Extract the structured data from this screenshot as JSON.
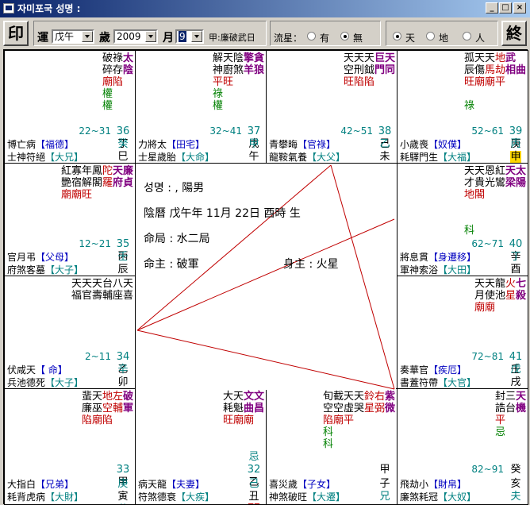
{
  "window": {
    "title": "자미포국    성명 :",
    "minimize": "_",
    "maximize": "□",
    "close": "×"
  },
  "toolbar": {
    "print_label": "印",
    "fortune_label": "運",
    "fortune_value": "戊午",
    "year_label": "歲",
    "year_value": "2009",
    "month_label": "月",
    "month_value": "9",
    "info_text": "甲:廉破武日",
    "flow_label": "流星：",
    "flow_options": [
      "有",
      "無"
    ],
    "flow_selected": 1,
    "view_options": [
      "天",
      "地",
      "人"
    ],
    "view_selected": 0,
    "end_label": "終"
  },
  "center": {
    "name_line": "성명 : , 陽男",
    "lunar_line": "陰曆  戊午年  11月  22日  酉時  生",
    "ming_ju_label": "命局 :",
    "ming_ju_value": "水二局",
    "ming_zhu_label": "命主 :",
    "ming_zhu_value": "破軍",
    "shen_zhu_label": "身主 :",
    "shen_zhu_value": "火星"
  },
  "palaces": [
    {
      "id": "si",
      "stars": [
        {
          "t": "破碎",
          "c": ""
        },
        {
          "t": "祿存",
          "c": ""
        },
        {
          "t": "太陰",
          "c": "b"
        }
      ],
      "sub": [
        {
          "t": "",
          "c": ""
        },
        {
          "t": "",
          "c": ""
        },
        {
          "t": "陷",
          "c": "r"
        }
      ],
      "extra": [
        {
          "t": "廟",
          "c": "r",
          "col": 1
        },
        {
          "t": "權",
          "c": "g",
          "col": 2
        },
        {
          "t": "權",
          "c": "g",
          "col": 2
        }
      ],
      "age": "22~31",
      "num": "36",
      "gz1": "丁",
      "gz2": "巳",
      "gz2b": "癸",
      "gz2c": "官",
      "row1": "博亡病",
      "row1b": "【福德】",
      "row2": "士神符絕",
      "row2b": "【大兄】"
    },
    {
      "id": "wu",
      "stars": [
        {
          "t": "解天陰",
          "c": ""
        },
        {
          "t": "擎",
          "c": "b"
        },
        {
          "t": "貪",
          "c": "b"
        }
      ],
      "age": "32~41",
      "num": "37",
      "gz1": "戊",
      "gz2": "午",
      "gz2b": "甲",
      "gz2c": "奴",
      "row1": "力將太",
      "row1b": "【田宅】",
      "row2": "士星歲胎",
      "row2b": "【大命】"
    },
    {
      "id": "wei",
      "stars": [
        {
          "t": "天天",
          "c": ""
        },
        {
          "t": "天",
          "c": ""
        },
        {
          "t": "巨天",
          "c": "b"
        }
      ],
      "age": "42~51",
      "num": "38",
      "gz1": "己",
      "gz2": "未",
      "gz2b": "乙",
      "gz2c": "遷",
      "row1": "青攀晦",
      "row1b": "【官祿】",
      "row2": "龍鞍氣養",
      "row2b": "【大父】"
    },
    {
      "id": "shen",
      "stars": [
        {
          "t": "孤天天",
          "c": ""
        },
        {
          "t": "地",
          "c": "r"
        },
        {
          "t": "武",
          "c": "b"
        }
      ],
      "age": "52~61",
      "num": "39",
      "gz1": "庚",
      "gz2": "申",
      "gz2b": "丙",
      "gz2c": "疾",
      "row1": "小歲喪",
      "row1b": "【奴僕】",
      "row2": "耗驛門生",
      "row2b": "【大福】"
    },
    {
      "id": "chen",
      "stars": [
        {
          "t": "紅寡年鳳",
          "c": ""
        },
        {
          "t": "陀",
          "c": "r"
        },
        {
          "t": "天廉",
          "c": "b"
        }
      ],
      "age": "12~21",
      "num": "35",
      "gz1": "丙",
      "gz2": "辰",
      "gz2b": "壬",
      "gz2c": "田",
      "row1": "官月弔",
      "row1b": "【父母】",
      "row2": "府煞客墓",
      "row2b": "【大子】"
    },
    {
      "id": "you",
      "stars": [
        {
          "t": "天天恩紅",
          "c": ""
        },
        {
          "t": "天",
          "c": "b"
        },
        {
          "t": "太",
          "c": "b"
        }
      ],
      "age": "62~71",
      "num": "40",
      "gz1": "辛",
      "gz2": "酉",
      "gz2b": "丁",
      "gz2c": "財",
      "row1": "將息貫",
      "row1b": "【身遷移】",
      "row2": "軍神索浴",
      "row2b": "【大田】"
    },
    {
      "id": "mao",
      "stars": [
        {
          "t": "天天天台八天",
          "c": ""
        }
      ],
      "age": "2~11",
      "num": "34",
      "gz1": "乙",
      "gz2": "卯",
      "gz2b": "辛",
      "gz2c": "福",
      "row1": "伏咸天",
      "row1b": "【  命】",
      "row2": "兵池德死",
      "row2b": "【大子】"
    },
    {
      "id": "xu",
      "stars": [
        {
          "t": "天天龍",
          "c": ""
        },
        {
          "t": "火",
          "c": "r"
        },
        {
          "t": "七",
          "c": "b"
        }
      ],
      "age": "72~81",
      "num": "41",
      "gz1": "壬",
      "gz2": "戌",
      "gz2b": "戊",
      "gz2c": "子",
      "row1": "奏華官",
      "row1b": "【疾厄】",
      "row2": "書蓋符帶",
      "row2b": "【大官】"
    },
    {
      "id": "yin",
      "stars": [
        {
          "t": "蜚天",
          "c": ""
        },
        {
          "t": "地左",
          "c": "r"
        },
        {
          "t": "破",
          "c": "b"
        }
      ],
      "age": "",
      "num": "33",
      "gz1": "甲",
      "gz2": "寅",
      "gz2b": "庚",
      "gz2c": "父",
      "row1": "大指白",
      "row1b": "【兄弟】",
      "row2": "耗背虎病",
      "row2b": "【大財】"
    },
    {
      "id": "chou",
      "stars": [
        {
          "t": "大天",
          "c": ""
        },
        {
          "t": "文文",
          "c": "b"
        }
      ],
      "age": "",
      "num": "32",
      "gz1": "乙",
      "gz2": "丑",
      "gz2b": "己",
      "gz2c": "命",
      "row1": "病天龍",
      "row1b": "【夫妻】",
      "row2": "符煞德衰",
      "row2b": "【大疾】"
    },
    {
      "id": "zi",
      "stars": [
        {
          "t": "旬截天天",
          "c": ""
        },
        {
          "t": "鈴右",
          "c": "r"
        },
        {
          "t": "紫",
          "c": "b"
        }
      ],
      "age": "",
      "num": "",
      "gz1": "甲",
      "gz2": "子",
      "gz2b": "",
      "gz2c": "兄",
      "row1": "喜災歲",
      "row1b": "【子女】",
      "row2": "神煞破旺",
      "row2b": "【大遷】"
    },
    {
      "id": "hai",
      "stars": [
        {
          "t": "封三",
          "c": ""
        },
        {
          "t": "天",
          "c": "b"
        }
      ],
      "age": "82~91",
      "num": "",
      "gz1": "癸",
      "gz2": "亥",
      "gz2b": "",
      "gz2c": "夫",
      "row1": "飛劫小",
      "row1b": "【財帛】",
      "row2": "廉煞耗冠",
      "row2b": "【大奴】"
    }
  ]
}
